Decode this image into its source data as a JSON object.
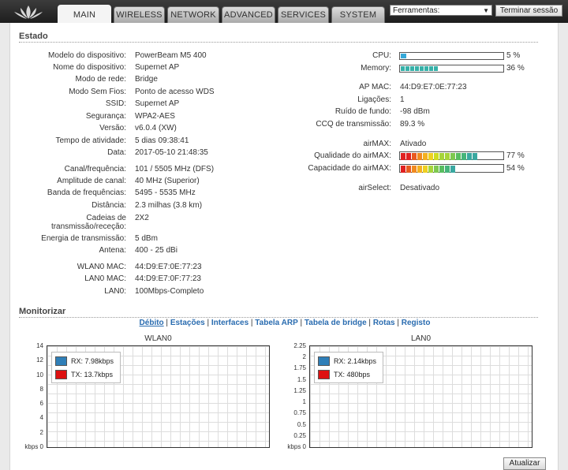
{
  "tabs": [
    {
      "label": "MAIN",
      "active": true
    },
    {
      "label": "WIRELESS"
    },
    {
      "label": "NETWORK"
    },
    {
      "label": "ADVANCED"
    },
    {
      "label": "SERVICES"
    },
    {
      "label": "SYSTEM"
    }
  ],
  "toolbar": {
    "tools_value": "Ferramentas:",
    "logout_label": "Terminar sessão"
  },
  "status": {
    "title": "Estado",
    "left": [
      {
        "label": "Modelo do dispositivo:",
        "value": "PowerBeam M5 400"
      },
      {
        "label": "Nome do dispositivo:",
        "value": "Supernet AP"
      },
      {
        "label": "Modo de rede:",
        "value": "Bridge"
      },
      {
        "label": "Modo Sem Fios:",
        "value": "Ponto de acesso WDS"
      },
      {
        "label": "SSID:",
        "value": "Supernet AP"
      },
      {
        "label": "Segurança:",
        "value": "WPA2-AES"
      },
      {
        "label": "Versão:",
        "value": "v6.0.4 (XW)"
      },
      {
        "label": "Tempo de atividade:",
        "value": "5 dias 09:38:41"
      },
      {
        "label": "Data:",
        "value": "2017-05-10 21:48:35"
      },
      {
        "label": "Canal/frequência:",
        "value": "101 / 5505 MHz (DFS)"
      },
      {
        "label": "Amplitude de canal:",
        "value": "40 MHz (Superior)"
      },
      {
        "label": "Banda de frequências:",
        "value": "5495 - 5535 MHz"
      },
      {
        "label": "Distância:",
        "value": "2.3 milhas (3.8 km)"
      },
      {
        "label": "Cadeias de",
        "label2": "transmissão/receção:",
        "value": "2X2"
      },
      {
        "label": "Energia de transmissão:",
        "value": "5 dBm"
      },
      {
        "label": "Antena:",
        "value": "400 - 25 dBi"
      },
      {
        "label": "WLAN0 MAC:",
        "value": "44:D9:E7:0E:77:23"
      },
      {
        "label": "LAN0 MAC:",
        "value": "44:D9:E7:0F:77:23"
      },
      {
        "label": "LAN0:",
        "value": "100Mbps-Completo"
      }
    ],
    "cpu": {
      "label": "CPU:",
      "value": "5 %",
      "percent": 5
    },
    "memory": {
      "label": "Memory:",
      "value": "36 %",
      "percent": 36
    },
    "right": [
      {
        "label": "AP MAC:",
        "value": "44:D9:E7:0E:77:23"
      },
      {
        "label": "Ligações:",
        "value": "1"
      },
      {
        "label": "Ruído de fundo:",
        "value": "-98 dBm"
      },
      {
        "label": "CCQ de transmissão:",
        "value": "89.3 %"
      },
      {
        "label": "airMAX:",
        "value": "Ativado"
      }
    ],
    "airmax_quality": {
      "label": "Qualidade do airMAX:",
      "value": "77 %",
      "percent": 77
    },
    "airmax_capacity": {
      "label": "Capacidade do airMAX:",
      "value": "54 %",
      "percent": 54
    },
    "airselect": {
      "label": "airSelect:",
      "value": "Desativado"
    }
  },
  "monitor": {
    "title": "Monitorizar",
    "links": [
      "Débito",
      "Estações",
      "Interfaces",
      "Tabela ARP",
      "Tabela de bridge",
      "Rotas",
      "Registo"
    ],
    "refresh_label": "Atualizar"
  },
  "colors": {
    "rx": "#2f7fb8",
    "tx": "#dd1111",
    "cpu": "#35a8d8"
  },
  "chart_data": [
    {
      "type": "line",
      "title": "WLAN0",
      "y_ticks": [
        "14",
        "12",
        "10",
        "8",
        "6",
        "4",
        "2",
        "kbps 0"
      ],
      "ylim": [
        0,
        14
      ],
      "grid": true,
      "legend": "top-left",
      "series": [
        {
          "name": "RX: 7.98kbps",
          "values": []
        },
        {
          "name": "TX: 13.7kbps",
          "values": []
        }
      ]
    },
    {
      "type": "line",
      "title": "LAN0",
      "y_ticks": [
        "2.25",
        "2",
        "1.75",
        "1.5",
        "1.25",
        "1",
        "0.75",
        "0.5",
        "0.25",
        "kbps 0"
      ],
      "ylim": [
        0,
        2.25
      ],
      "grid": true,
      "legend": "top-left",
      "series": [
        {
          "name": "RX: 2.14kbps",
          "values": []
        },
        {
          "name": "TX: 480bps",
          "values": []
        }
      ]
    }
  ]
}
